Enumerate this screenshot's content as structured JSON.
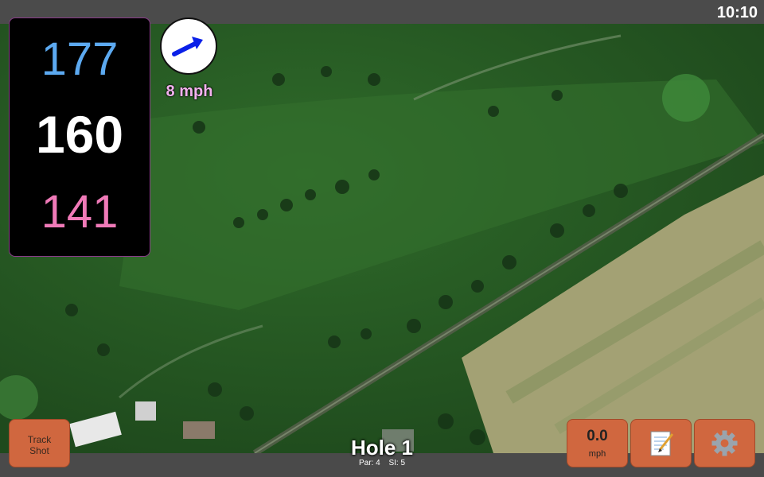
{
  "status": {
    "time": "10:10"
  },
  "yardage": {
    "back": "177",
    "middle": "160",
    "front": "141"
  },
  "wind": {
    "speed": "8 mph",
    "direction_icon": "wind-arrow-icon"
  },
  "hole": {
    "title": "Hole 1",
    "par": "Par: 4",
    "si": "SI: 5"
  },
  "buttons": {
    "track_line1": "Track",
    "track_line2": "Shot",
    "speed_value": "0.0",
    "speed_unit": "mph",
    "notes_icon": "notepad-icon",
    "settings_icon": "gear-icon"
  },
  "colors": {
    "back": "#5ca9f0",
    "middle": "#ffffff",
    "front": "#f07ab8",
    "button": "#d0673f",
    "wind_text": "#f3b2ee"
  }
}
